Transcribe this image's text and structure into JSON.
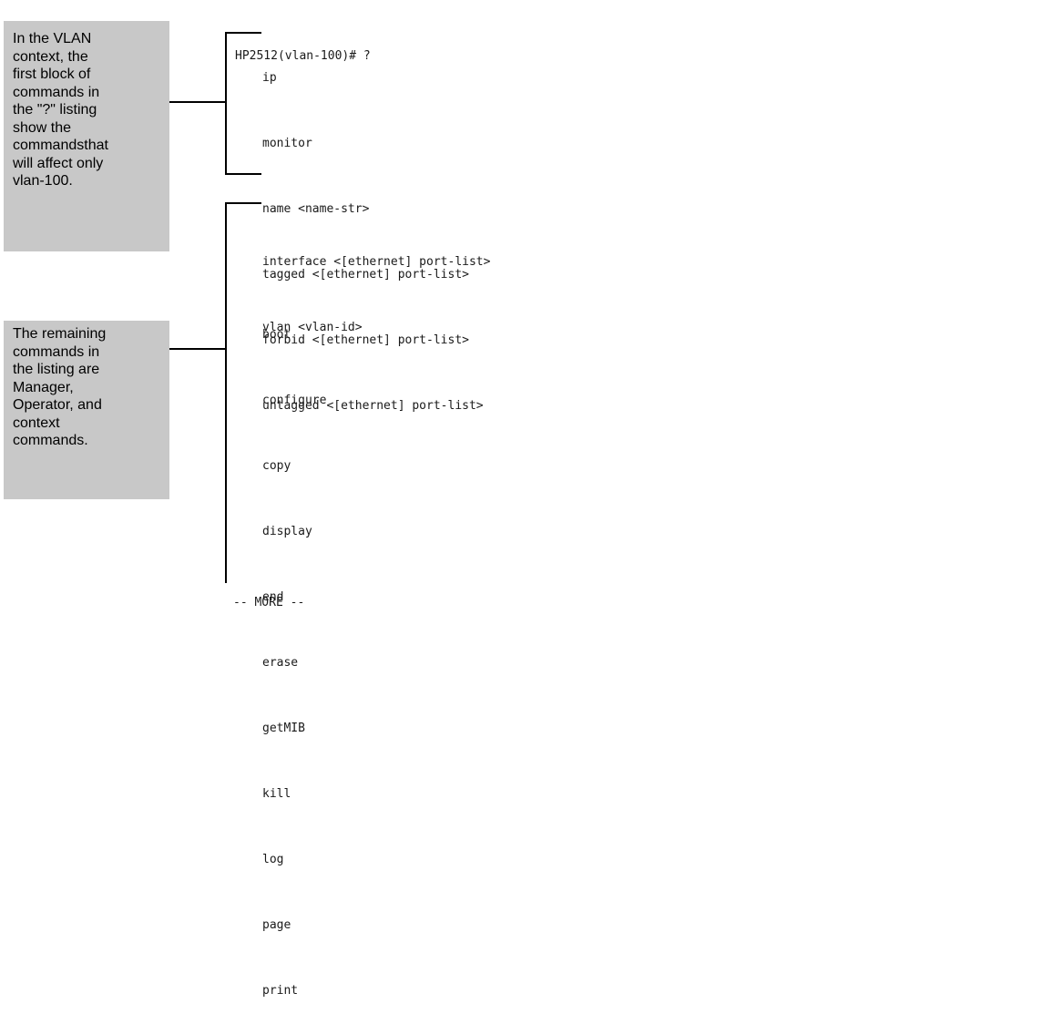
{
  "callouts": {
    "vlan_block": "In the VLAN\ncontext, the\nfirst block of\ncommands in\nthe \"?\" listing\nshow the\ncommandsthat\nwill affect only\nvlan-100.",
    "remaining": "The remaining\ncommands in\nthe listing are\nManager,\nOperator, and\ncontext\ncommands."
  },
  "terminal": {
    "prompt": "HP2512(vlan-100)# ?",
    "vlan_commands": [
      "ip",
      "monitor",
      "name <name-str>",
      "tagged <[ethernet] port-list>",
      "forbid <[ethernet] port-list>",
      "untagged <[ethernet] port-list>"
    ],
    "context_commands": [
      "interface <[ethernet] port-list>",
      "vlan <vlan-id>"
    ],
    "manager_commands": [
      "boot",
      "configure",
      "copy",
      "display",
      "end",
      "erase",
      "getMIB",
      "kill",
      "log",
      "page",
      "print"
    ],
    "more_prompt": "-- MORE --"
  },
  "colors": {
    "callout_background": "#c8c8c8",
    "bracket": "#000000",
    "text": "#1a1a1a"
  }
}
